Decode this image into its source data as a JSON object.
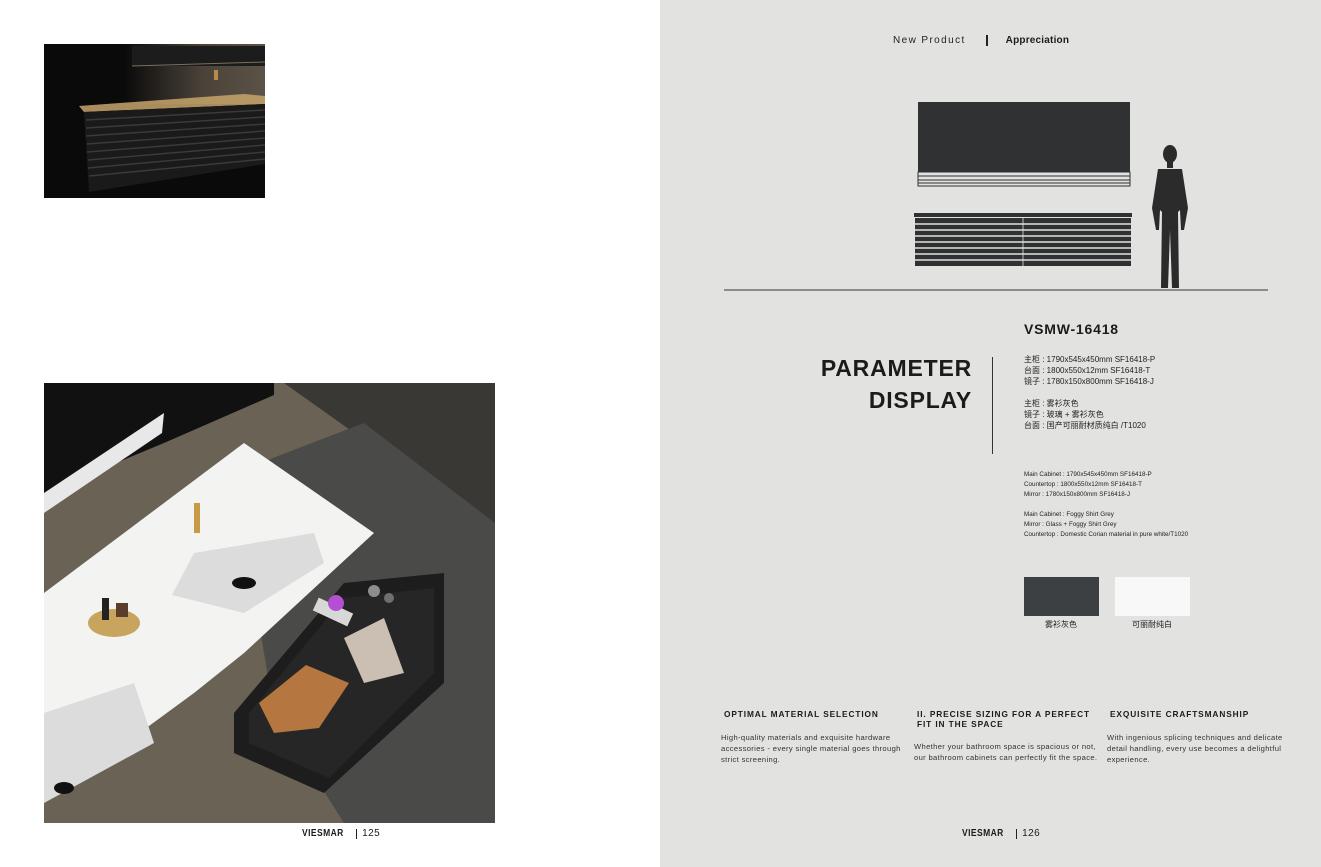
{
  "left_page": {
    "footer": {
      "brand": "VIESMAR",
      "page": "125"
    }
  },
  "right_page": {
    "nav": {
      "new_product": "New Product",
      "appreciation": "Appreciation"
    },
    "model": "VSMW-16418",
    "title": {
      "line1": "PARAMETER",
      "line2": "DISPLAY"
    },
    "spec_cn_dimensions": [
      "主柜 : 1790x545x450mm SF16418-P",
      "台面 : 1800x550x12mm SF16418-T",
      "镜子 : 1780x150x800mm SF16418-J"
    ],
    "spec_cn_materials": [
      "主柜 : 雾衫灰色",
      "镜子 : 玻璃 + 雾衫灰色",
      "台面 : 国产可丽耐材质纯白 /T1020"
    ],
    "spec_en_dimensions": [
      "Main Cabinet : 1790x545x450mm SF16418-P",
      "Countertop : 1800x550x12mm SF16418-T",
      "Mirror : 1780x150x800mm SF16418-J"
    ],
    "spec_en_materials": [
      "Main Cabinet : Foggy Shirt Grey",
      "Mirror : Glass + Foggy Shirt Grey",
      "Countertop : Domestic Corian material in pure white/T1020"
    ],
    "swatches": [
      {
        "label": "雾衫灰色",
        "color": "#3c4043"
      },
      {
        "label": "可丽耐纯白",
        "color": "#f8f8f8"
      }
    ],
    "features": [
      {
        "title": "OPTIMAL MATERIAL SELECTION",
        "text": "High-quality materials and exquisite hardware accessories - every single material goes through strict screening."
      },
      {
        "title": "II. PRECISE SIZING FOR A PERFECT FIT IN THE SPACE",
        "text": "Whether your bathroom space is spacious or not, our bathroom cabinets can perfectly fit the space."
      },
      {
        "title": "EXQUISITE CRAFTSMANSHIP",
        "text": "With ingenious splicing techniques and delicate detail handling, every use becomes a delightful experience."
      }
    ],
    "footer": {
      "brand": "VIESMAR",
      "page": "126"
    }
  },
  "colors": {
    "right_page_bg": "#e2e3e0",
    "cabinet_dark": "#2f3133"
  }
}
